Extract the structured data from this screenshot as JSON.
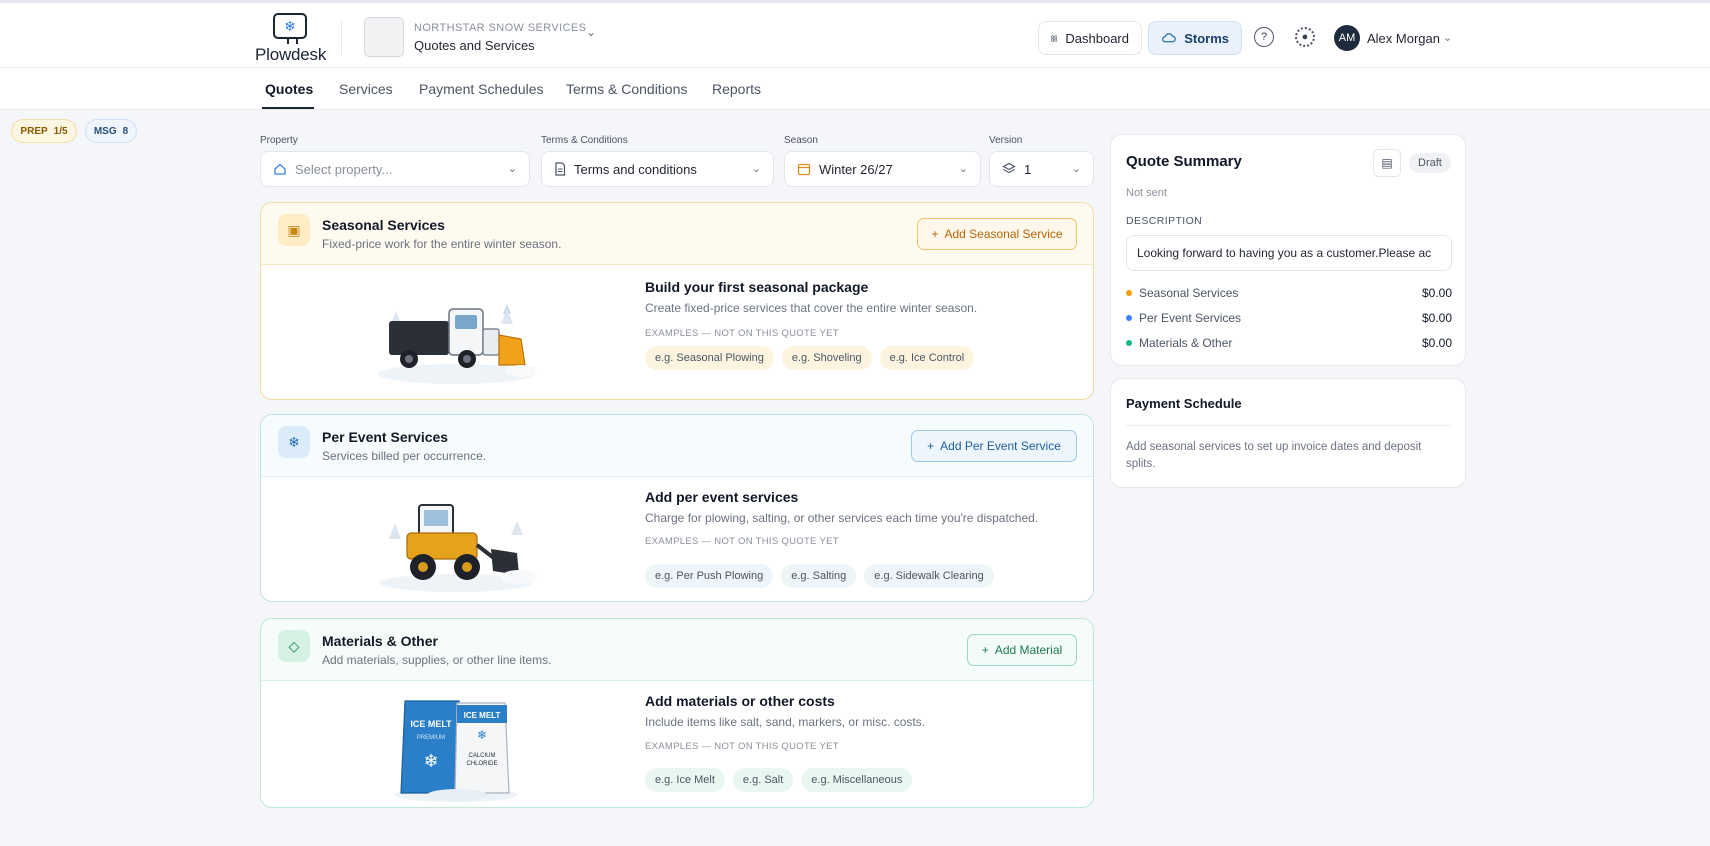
{
  "app": {
    "name": "Plowdesk"
  },
  "company": {
    "name": "NORTHSTAR SNOW SERVICES",
    "page": "Quotes and Services"
  },
  "header": {
    "dashboard_label": "Dashboard",
    "storms_label": "Storms",
    "user": {
      "initials": "AM",
      "name": "Alex Morgan"
    }
  },
  "tabs": [
    {
      "label": "Quotes",
      "active": true
    },
    {
      "label": "Services",
      "active": false
    },
    {
      "label": "Payment Schedules",
      "active": false
    },
    {
      "label": "Terms & Conditions",
      "active": false
    },
    {
      "label": "Reports",
      "active": false
    }
  ],
  "debug": {
    "prep": {
      "tag": "PREP",
      "value": "1/5"
    },
    "msg": {
      "tag": "MSG",
      "value": "8"
    }
  },
  "filters": {
    "property": {
      "label": "Property",
      "placeholder": "Select property..."
    },
    "terms": {
      "label": "Terms & Conditions",
      "value": "Terms and conditions"
    },
    "season": {
      "label": "Season",
      "value": "Winter 26/27"
    },
    "version": {
      "label": "Version",
      "value": "1"
    }
  },
  "sections": {
    "seasonal": {
      "title": "Seasonal Services",
      "subtitle": "Fixed-price work for the entire winter season.",
      "button": "Add Seasonal Service",
      "heading": "Build your first seasonal package",
      "text": "Create fixed-price services that cover the entire winter season.",
      "examples_label": "EXAMPLES — NOT ON THIS QUOTE YET",
      "examples": [
        "e.g. Seasonal Plowing",
        "e.g. Shoveling",
        "e.g. Ice Control"
      ]
    },
    "per_event": {
      "title": "Per Event Services",
      "subtitle": "Services billed per occurrence.",
      "button": "Add Per Event Service",
      "heading": "Add per event services",
      "text": "Charge for plowing, salting, or other services each time you're dispatched.",
      "examples_label": "EXAMPLES — NOT ON THIS QUOTE YET",
      "examples": [
        "e.g. Per Push Plowing",
        "e.g. Salting",
        "e.g. Sidewalk Clearing"
      ]
    },
    "materials": {
      "title": "Materials & Other",
      "subtitle": "Add materials, supplies, or other line items.",
      "button": "Add Material",
      "heading": "Add materials or other costs",
      "text": "Include items like salt, sand, markers, or misc. costs.",
      "examples_label": "EXAMPLES — NOT ON THIS QUOTE YET",
      "examples": [
        "e.g. Ice Melt",
        "e.g. Salt",
        "e.g. Miscellaneous"
      ],
      "bag_left": {
        "line1": "ICE MELT",
        "line2": "PREMIUM"
      },
      "bag_right": {
        "line1": "ICE MELT",
        "line2": "CALCIUM",
        "line3": "CHLORIDE"
      }
    }
  },
  "summary": {
    "title": "Quote Summary",
    "badge": "Draft",
    "status": "Not sent",
    "description_label": "DESCRIPTION",
    "description": "Looking forward to having you as a customer.Please ac",
    "rows": [
      {
        "label": "Seasonal Services",
        "amount": "$0.00",
        "color": "#f59e0b"
      },
      {
        "label": "Per Event Services",
        "amount": "$0.00",
        "color": "#3b82f6"
      },
      {
        "label": "Materials & Other",
        "amount": "$0.00",
        "color": "#10b981"
      }
    ]
  },
  "payment": {
    "title": "Payment Schedule",
    "text": "Add seasonal services to set up invoice dates and deposit splits."
  }
}
